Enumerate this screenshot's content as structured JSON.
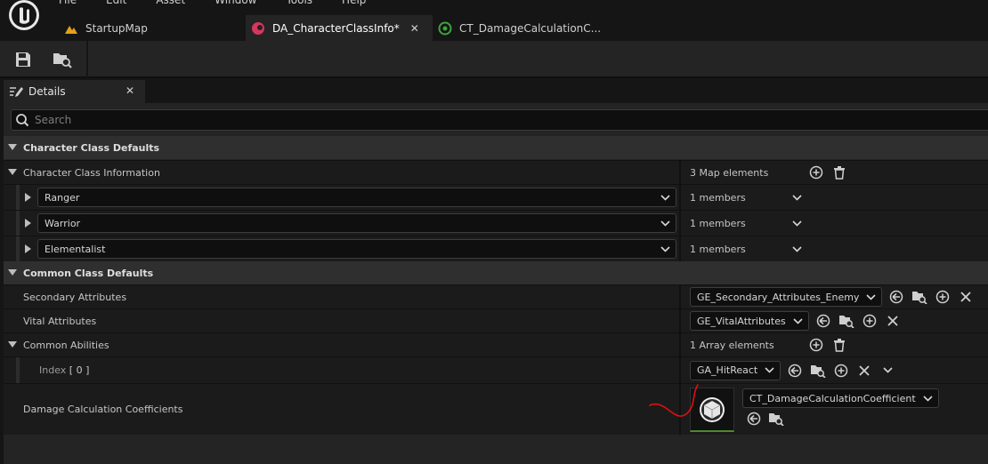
{
  "menu": [
    "File",
    "Edit",
    "Asset",
    "Window",
    "Tools",
    "Help"
  ],
  "tabs": [
    {
      "label": "StartupMap",
      "active": false,
      "icon": "level-icon"
    },
    {
      "label": "DA_CharacterClassInfo*",
      "active": true,
      "icon": "data-asset-icon"
    },
    {
      "label": "CT_DamageCalculationC...",
      "active": false,
      "icon": "curve-table-icon"
    }
  ],
  "toolbar": {
    "save": "save-icon",
    "browse": "browse-asset-icon"
  },
  "details": {
    "tab_label": "Details",
    "search_placeholder": "Search",
    "cat_character_defaults": "Character Class Defaults",
    "character_class_info": {
      "label": "Character Class Information",
      "value": "3 Map elements",
      "entries": [
        {
          "key": "Ranger",
          "value": "1 members"
        },
        {
          "key": "Warrior",
          "value": "1 members"
        },
        {
          "key": "Elementalist",
          "value": "1 members"
        }
      ]
    },
    "cat_common_defaults": "Common Class Defaults",
    "secondary_attributes": {
      "label": "Secondary Attributes",
      "value": "GE_Secondary_Attributes_Enemy"
    },
    "vital_attributes": {
      "label": "Vital Attributes",
      "value": "GE_VitalAttributes"
    },
    "common_abilities": {
      "label": "Common Abilities",
      "value": "1 Array elements"
    },
    "index0": {
      "label": "Index",
      "index_text": "[ 0 ]",
      "value": "GA_HitReact"
    },
    "damage_coefficients": {
      "label": "Damage Calculation Coefficients",
      "value": "CT_DamageCalculationCoefficient"
    }
  },
  "colors": {
    "accent_green": "#4c8a2d",
    "annotation_red": "#e01010",
    "active_tab_icon": "#d63660"
  }
}
